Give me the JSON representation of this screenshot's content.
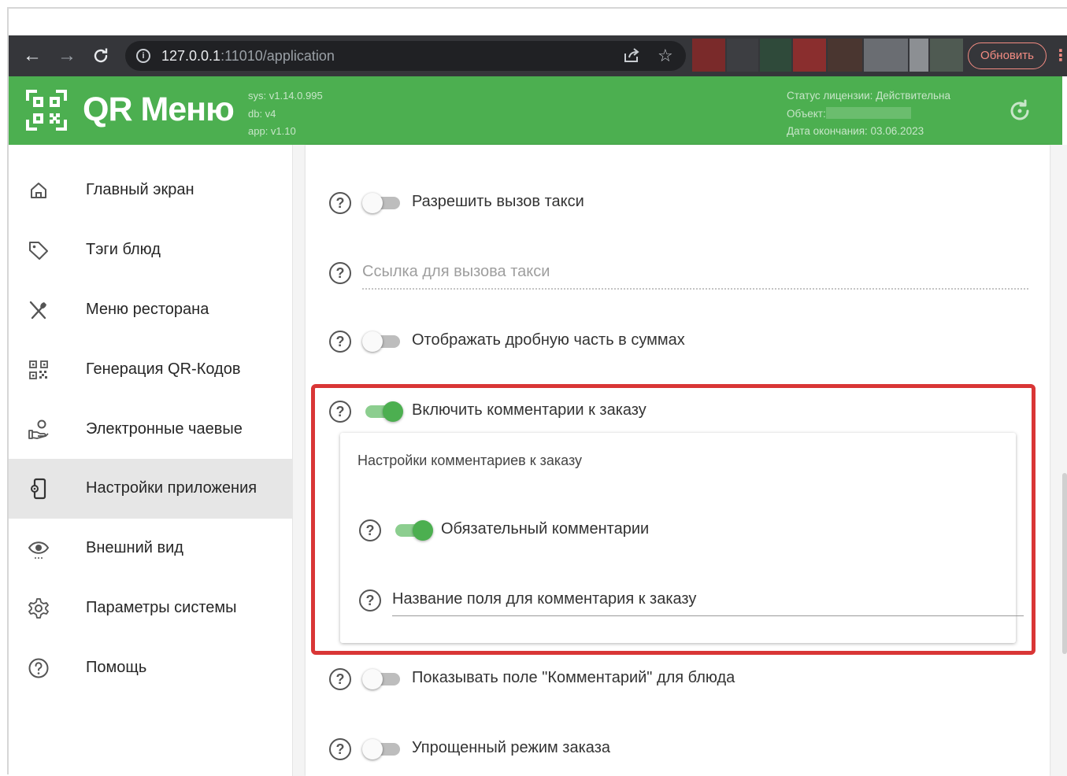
{
  "browser": {
    "url_host": "127.0.0.1",
    "url_path": ":11010/application",
    "update_label": "Обновить"
  },
  "header": {
    "title": "QR Меню",
    "sys": "sys: v1.14.0.995",
    "db": "db: v4",
    "app": "app: v1.10",
    "license_status": "Статус лицензии: Действительна",
    "object_label": "Объект:",
    "expiry": "Дата окончания: 03.06.2023"
  },
  "sidebar": {
    "items": [
      {
        "label": "Главный экран",
        "icon": "home-icon"
      },
      {
        "label": "Тэги блюд",
        "icon": "tag-icon"
      },
      {
        "label": "Меню ресторана",
        "icon": "cutlery-icon"
      },
      {
        "label": "Генерация QR-Кодов",
        "icon": "qr-code-icon"
      },
      {
        "label": "Электронные чаевые",
        "icon": "tips-icon"
      },
      {
        "label": "Настройки приложения",
        "icon": "app-settings-icon",
        "active": true
      },
      {
        "label": "Внешний вид",
        "icon": "eye-icon"
      },
      {
        "label": "Параметры системы",
        "icon": "gear-icon"
      },
      {
        "label": "Помощь",
        "icon": "help-icon"
      }
    ]
  },
  "settings": {
    "taxi_call": {
      "label": "Разрешить вызов такси",
      "enabled": false
    },
    "taxi_link": {
      "placeholder": "Ссылка для вызова такси"
    },
    "fraction": {
      "label": "Отображать дробную часть в суммах",
      "enabled": false
    },
    "order_comments": {
      "label": "Включить комментарии к заказу",
      "enabled": true
    },
    "comments_section": {
      "title": "Настройки комментариев к заказу",
      "required": {
        "label": "Обязательный комментарии",
        "enabled": true
      },
      "field_name": {
        "label": "Название поля для комментария к заказу"
      }
    },
    "dish_comment": {
      "label": "Показывать поле \"Комментарий\" для блюда",
      "enabled": false
    },
    "simple_mode": {
      "label": "Упрощенный режим заказа",
      "enabled": false
    }
  },
  "colors": {
    "brand_green": "#4caf50",
    "highlight_red": "#d93636",
    "browser_dark": "#35363a"
  }
}
